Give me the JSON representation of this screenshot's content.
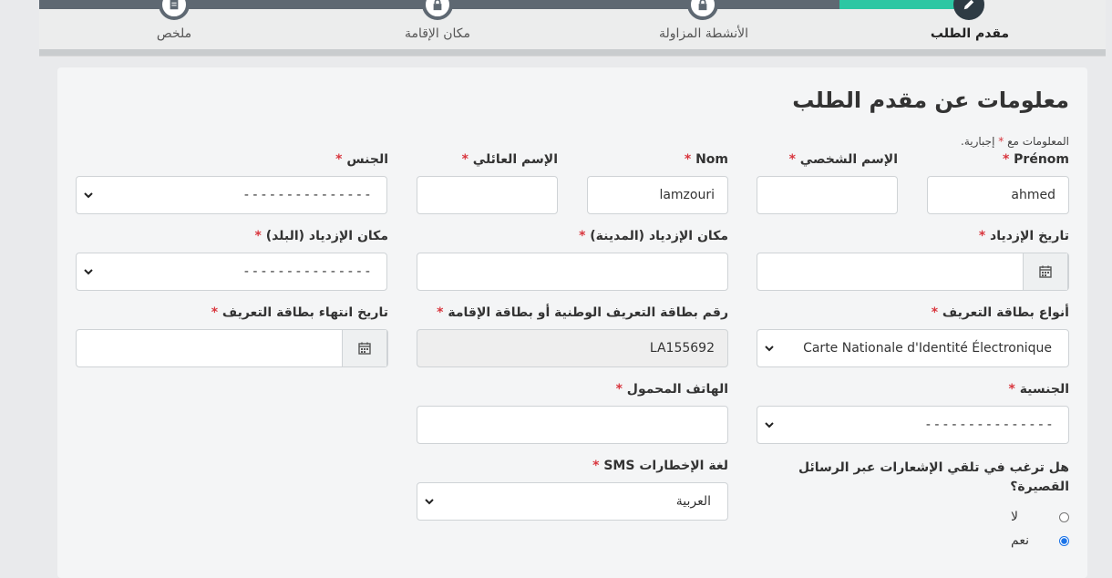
{
  "stepper": {
    "steps": [
      {
        "label": "مقدم الطلب",
        "active": true,
        "icon": "pencil-icon"
      },
      {
        "label": "الأنشطة المزاولة",
        "active": false,
        "icon": "lock-icon"
      },
      {
        "label": "مكان الإقامة",
        "active": false,
        "icon": "lock-icon"
      },
      {
        "label": "ملخص",
        "active": false,
        "icon": "document-icon"
      }
    ]
  },
  "form": {
    "title": "معلومات عن مقدم الطلب",
    "required_note_prefix": "المعلومات مع",
    "required_note_suffix": "إجبارية.",
    "required_star": "*",
    "fields": {
      "prenom": {
        "label": "Prénom",
        "value": "ahmed"
      },
      "first_name_ar": {
        "label": "الإسم الشخصي",
        "value": ""
      },
      "nom": {
        "label": "Nom",
        "value": "lamzouri"
      },
      "last_name_ar": {
        "label": "الإسم العائلي",
        "value": ""
      },
      "gender": {
        "label": "الجنس",
        "value": "- - - - - - - - - - - - - - -"
      },
      "birth_date": {
        "label": "تاريخ الإزدياد",
        "value": ""
      },
      "birth_city": {
        "label": "مكان الإزدياد (المدينة)",
        "value": ""
      },
      "birth_country": {
        "label": "مكان الإزدياد (البلد)",
        "value": "- - - - - - - - - - - - - - -"
      },
      "id_type": {
        "label": "أنواع بطاقة التعريف",
        "value": "Carte Nationale d'Identité Électronique"
      },
      "id_number": {
        "label": "رقم بطاقة التعريف الوطنية أو بطاقة الإقامة",
        "value": "LA155692"
      },
      "id_expiry": {
        "label": "تاريخ انتهاء بطاقة التعريف",
        "value": ""
      },
      "nationality": {
        "label": "الجنسية",
        "value": "- - - - - - - - - - - - - - -"
      },
      "mobile": {
        "label": "الهاتف المحمول",
        "value": ""
      },
      "sms_question": {
        "label": "هل ترغب في تلقي الإشعارات عبر الرسائل القصيرة؟"
      },
      "sms_language": {
        "label": "لغة الإخطارات SMS",
        "value": "العربية"
      }
    },
    "sms_options": [
      {
        "label": "لا",
        "checked": false
      },
      {
        "label": "نعم",
        "checked": true
      }
    ]
  },
  "colors": {
    "accent": "#2cc7a3",
    "step_inactive": "#5e6872",
    "required": "#d9363e",
    "radio_checked": "#1a73e8"
  }
}
